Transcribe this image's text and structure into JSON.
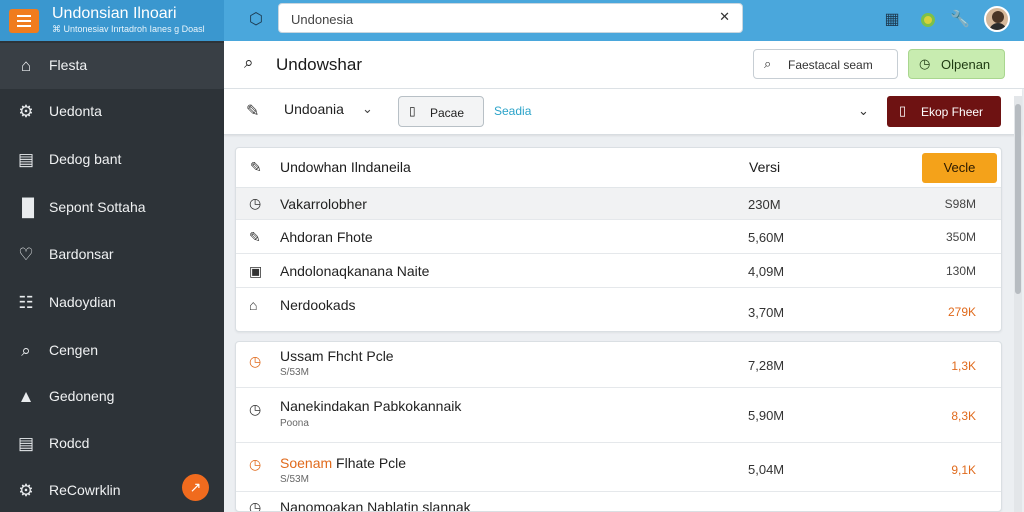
{
  "app": {
    "title": "Undonsian Ilnoari",
    "subtitle": "⌘ Untonesiav Inrtadroh Ianes ɡ Doasl"
  },
  "topbar": {
    "search_value": "Undonesia",
    "search_clear": "✕",
    "icons": [
      "extension-icon",
      "grid-icon",
      "status-dot-icon",
      "wrench-icon",
      "avatar"
    ]
  },
  "sidebar": {
    "items": [
      {
        "label": "Flesta",
        "icon": "home-icon",
        "active": true
      },
      {
        "label": "Uedonta",
        "icon": "gear-icon"
      },
      {
        "label": "Dedog bant",
        "icon": "chart-icon"
      },
      {
        "label": "Sepont Sottaha",
        "icon": "people-icon"
      },
      {
        "label": "Bardonsar",
        "icon": "heart-icon"
      },
      {
        "label": "Nadoydian",
        "icon": "document-icon"
      },
      {
        "label": "Cengen",
        "icon": "search-icon"
      },
      {
        "label": "Gedoneng",
        "icon": "upload-icon"
      },
      {
        "label": "Rodcd",
        "icon": "file-icon"
      },
      {
        "label": "ReCowrklin",
        "icon": "settings-icon"
      }
    ],
    "fab_label": "↗"
  },
  "header": {
    "title": "Undowshar",
    "outline_button": "Faestacal seam",
    "green_button": "Olpenan"
  },
  "filter": {
    "select_value": "Undoania",
    "chip_label": "Pacae",
    "link_label": "Seadia",
    "dark_button": "Ekop Fheer"
  },
  "table": {
    "header": {
      "name": "Undowhan Ilndaneila",
      "version": "Versi",
      "action": "Vecle"
    },
    "rows": [
      {
        "name": "Vakarrolobher",
        "version": "230M",
        "size": "S98M",
        "icon": "clock-icon",
        "alt": true
      },
      {
        "name": "Ahdoran Fhote",
        "version": "5,60M",
        "size": "350M",
        "icon": "edit-icon"
      },
      {
        "name": "Andolonaqkanana Naite",
        "version": "4,09M",
        "size": "130M",
        "icon": "image-icon"
      },
      {
        "name": "Nerdookads",
        "version": "3,70M",
        "size": "279K",
        "icon": "folder-icon",
        "highlight": true
      }
    ]
  },
  "table2": {
    "rows": [
      {
        "name": "Ussam Fhcht Pcle",
        "sub": "S/53M",
        "version": "7,28M",
        "size": "1,3K",
        "icon": "timer-icon",
        "orange_icon": true,
        "highlight": true
      },
      {
        "name": "Nanekindakan Pabkokannaik",
        "sub": "Poona",
        "version": "5,90M",
        "size": "8,3K",
        "icon": "timer-icon",
        "highlight": true
      },
      {
        "name": "Soenam Flhate Pcle",
        "name_orange": "Soenam",
        "name_rest": " Flhate Pcle",
        "sub": "S/53M",
        "version": "5,04M",
        "size": "9,1K",
        "icon": "timer-icon",
        "orange_icon": true,
        "highlight": true
      },
      {
        "name": "Nanomoakan Nablatin slannak",
        "version": "",
        "size": "",
        "icon": "timer-icon"
      }
    ]
  },
  "colors": {
    "topbar": "#4aa7dc",
    "sidebar": "#2d3338",
    "accent_orange": "#f07c1e",
    "button_green": "#c8ecb0",
    "button_dark": "#6e1212",
    "button_orange": "#f4a21a",
    "link": "#2ba3c9"
  }
}
